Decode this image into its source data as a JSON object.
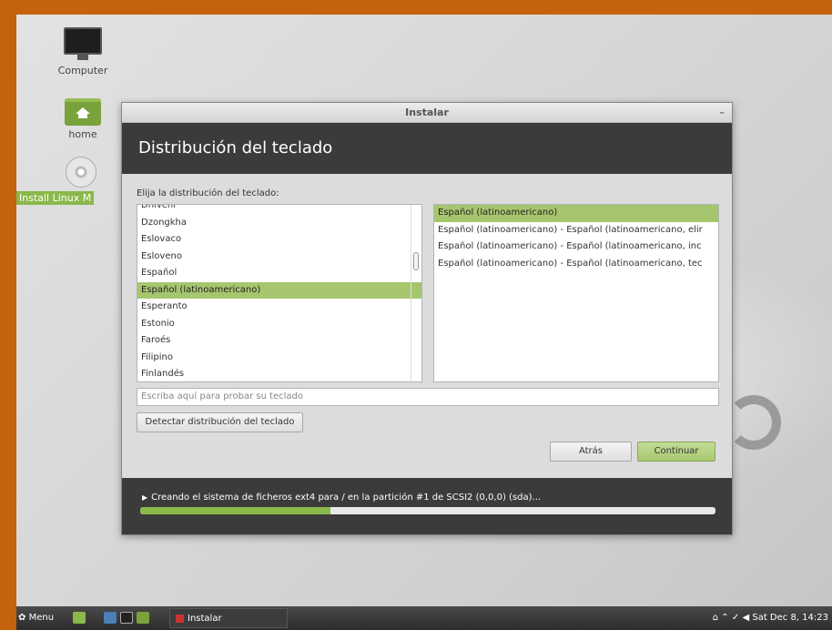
{
  "desktop": {
    "icons": [
      {
        "label": "Computer",
        "icon": "computer-icon"
      },
      {
        "label": "home",
        "icon": "home-folder-icon"
      },
      {
        "label": "Install Linux M",
        "icon": "disc-icon"
      }
    ]
  },
  "window": {
    "title": "Instalar",
    "minimize_glyph": "–",
    "header": "Distribución del teclado",
    "prompt": "Elija la distribución del teclado:",
    "layouts": [
      "Dhivehi",
      "Dzongkha",
      "Eslovaco",
      "Esloveno",
      "Español",
      "Español (latinoamericano)",
      "Esperanto",
      "Estonio",
      "Faroés",
      "Filipino",
      "Finlandés"
    ],
    "selected_layout": "Español (latinoamericano)",
    "variants": [
      "Español (latinoamericano)",
      "Español (latinoamericano) - Español (latinoamericano, elir",
      "Español (latinoamericano) - Español (latinoamericano, inc",
      "Español (latinoamericano) - Español (latinoamericano, tec"
    ],
    "selected_variant": "Español (latinoamericano)",
    "test_placeholder": "Escriba aquí para probar su teclado",
    "detect_button": "Detectar distribución del teclado",
    "back_button": "Atrás",
    "continue_button": "Continuar",
    "status_text": "Creando el sistema de ficheros ext4 para / en la partición #1 de SCSI2 (0,0,0) (sda)...",
    "progress": 0.33
  },
  "taskbar": {
    "menu_label": "Menu",
    "window_label": "Instalar",
    "clock": "Sat Dec  8, 14:23"
  },
  "colors": {
    "accent_green": "#8ab84a",
    "selection_green": "#a6c66e",
    "header_dark": "#3b3b3b",
    "border_orange": "#c4620e"
  }
}
